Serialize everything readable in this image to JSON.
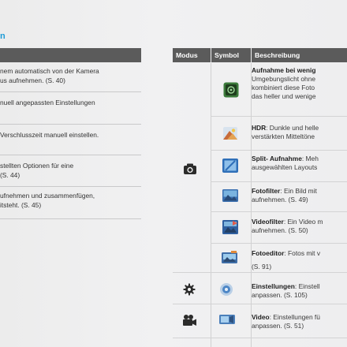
{
  "page": {
    "heading": "n"
  },
  "left_table": {
    "rows": [
      {
        "line1": "nem automatisch von der Kamera",
        "line2": "us aufnehmen. (S. 40)"
      },
      {
        "line1": "nuell angepassten Einstellungen",
        "line2": ""
      },
      {
        "line1": "Verschlusszeit manuell einstellen.",
        "line2": ""
      },
      {
        "line1": "stellten Optionen für eine",
        "line2": "(S. 44)"
      },
      {
        "line1": "ufnehmen und zusammenfügen,",
        "line2": "itsteht. (S. 45)"
      }
    ]
  },
  "right_table": {
    "headers": {
      "modus": "Modus",
      "symbol": "Symbol",
      "beschreibung": "Beschreibung"
    },
    "entries": [
      {
        "title": "Aufnahme bei wenig",
        "lines": [
          "Umgebungslicht ohne",
          "kombiniert diese Foto",
          "das heller und wenige"
        ],
        "icon": "night-mode-icon"
      },
      {
        "title": "HDR",
        "inline": ": Dunkle und helle",
        "lines": [
          "verstärkten Mitteltöne"
        ],
        "icon": "hdr-icon"
      },
      {
        "title": "Split- Aufnahme",
        "inline": ": Meh",
        "lines": [
          "ausgewählten Layouts"
        ],
        "icon": "split-shot-icon"
      },
      {
        "title": "Fotofilter",
        "inline": ": Ein Bild mit",
        "lines": [
          "aufnehmen. (S. 49)"
        ],
        "icon": "photo-filter-icon"
      },
      {
        "title": "Videofilter",
        "inline": ": Ein Video m",
        "lines": [
          "aufnehmen. (S. 50)"
        ],
        "icon": "video-filter-icon"
      },
      {
        "title": "Fotoeditor",
        "inline": ": Fotos mit v",
        "lines": [
          "(S. 91)"
        ],
        "icon": "photo-editor-icon"
      },
      {
        "title": "Einstellungen",
        "inline": ": Einstell",
        "lines": [
          "anpassen. (S. 105)"
        ],
        "icon": "settings-symbol-icon"
      },
      {
        "title": "Video",
        "inline": ": Einstellungen fü",
        "lines": [
          "anpassen. (S. 51)"
        ],
        "icon": "video-settings-symbol-icon"
      }
    ],
    "mode_icons": [
      "camera-mode-icon",
      "settings-mode-icon",
      "video-camera-mode-icon"
    ]
  },
  "colors": {
    "accent": "#1d9bd6",
    "header_bg": "#5b5b5b"
  }
}
